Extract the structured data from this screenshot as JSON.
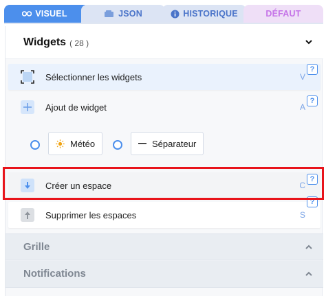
{
  "tabs": [
    {
      "label": "VISUEL",
      "icon": "eye-icon"
    },
    {
      "label": "JSON",
      "icon": "braces-icon"
    },
    {
      "label": "HISTORIQUE",
      "icon": "info-icon"
    },
    {
      "label": "DÉFAUT",
      "icon": ""
    }
  ],
  "widgets": {
    "title": "Widgets",
    "count": "( 28 )",
    "rows": [
      {
        "label": "Sélectionner les widgets",
        "key": "V",
        "icon": "select-icon"
      },
      {
        "label": "Ajout de widget",
        "key": "A",
        "icon": "plus-icon"
      },
      {
        "label": "Créer un espace",
        "key": "C",
        "icon": "arrow-down-icon"
      },
      {
        "label": "Supprimer les espaces",
        "key": "S",
        "icon": "arrow-up-icon"
      }
    ],
    "options": [
      {
        "label": "Météo",
        "icon": "sun-icon"
      },
      {
        "label": "Séparateur",
        "icon": "dash-icon"
      }
    ],
    "help": "?"
  },
  "sections": {
    "grille": "Grille",
    "notifications": "Notifications"
  },
  "colors": {
    "accent": "#4c8fec",
    "highlight": "#e8141b",
    "default_tab": "#c573e8"
  }
}
